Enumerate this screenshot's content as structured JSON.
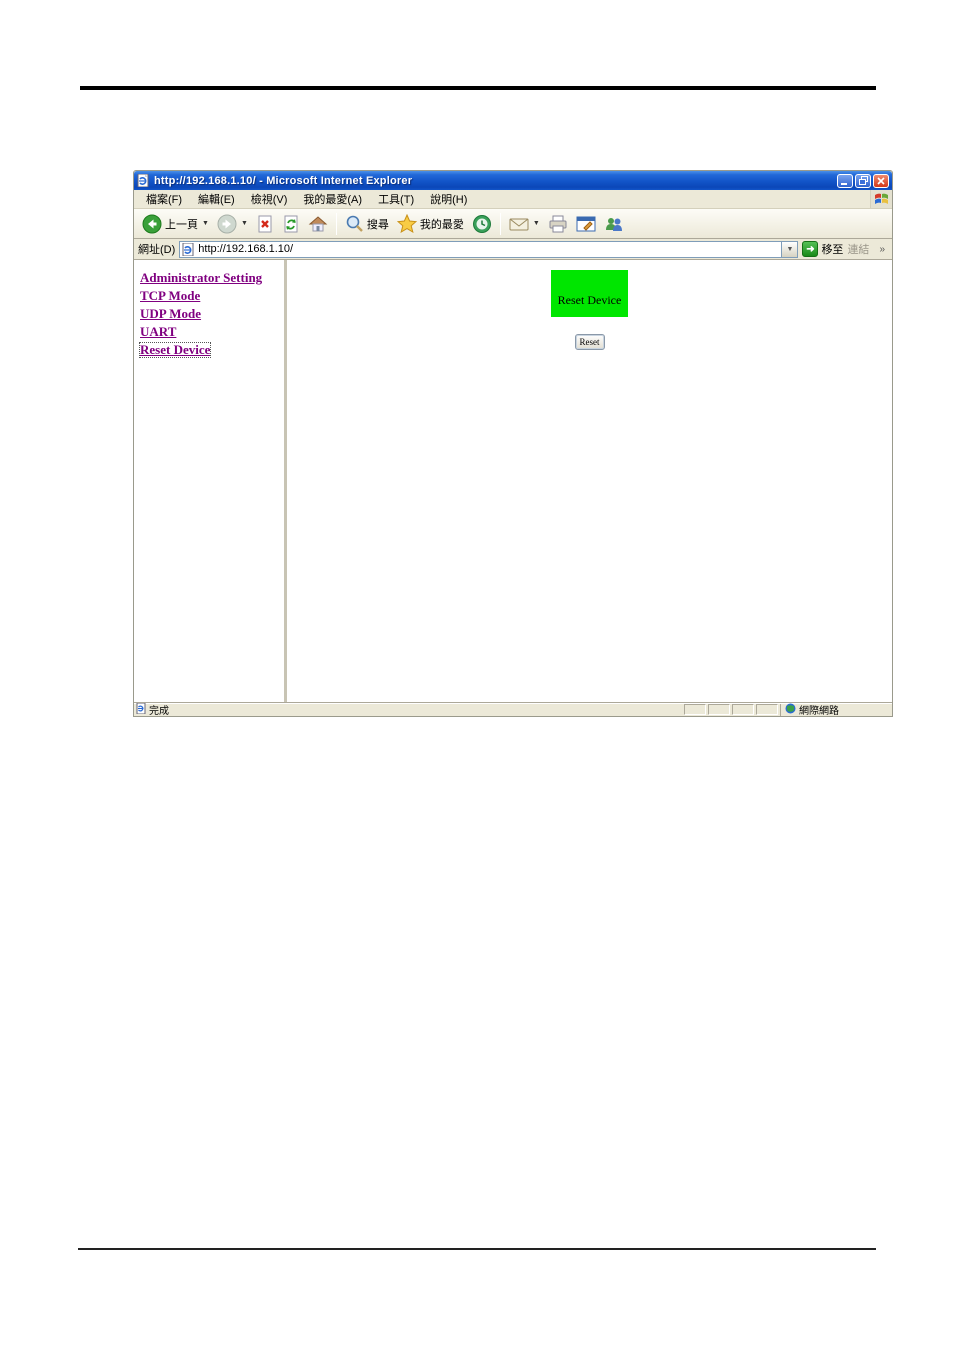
{
  "ie": {
    "title": "http://192.168.1.10/ - Microsoft Internet Explorer",
    "menubar": {
      "items": [
        "檔案(F)",
        "編輯(E)",
        "檢視(V)",
        "我的最愛(A)",
        "工具(T)",
        "說明(H)"
      ]
    },
    "toolbar": {
      "back_label": "上一頁",
      "search_label": "搜尋",
      "favorites_label": "我的最愛"
    },
    "address": {
      "label": "網址(D)",
      "url": "http://192.168.1.10/",
      "go_label": "移至",
      "links_label": "連結",
      "links_chevron": "»"
    },
    "sidebar": {
      "links": [
        "Administrator Setting",
        "TCP Mode",
        "UDP Mode",
        "UART",
        "Reset Device"
      ]
    },
    "main": {
      "banner_label": "Reset Device",
      "reset_button_label": "Reset"
    },
    "statusbar": {
      "status_text": "完成",
      "zone_text": "網際網路"
    },
    "colors": {
      "banner_green": "#00e600",
      "link_purple": "#800080",
      "titlebar_blue": "#1254c8",
      "chrome_beige": "#ece9d8"
    }
  }
}
